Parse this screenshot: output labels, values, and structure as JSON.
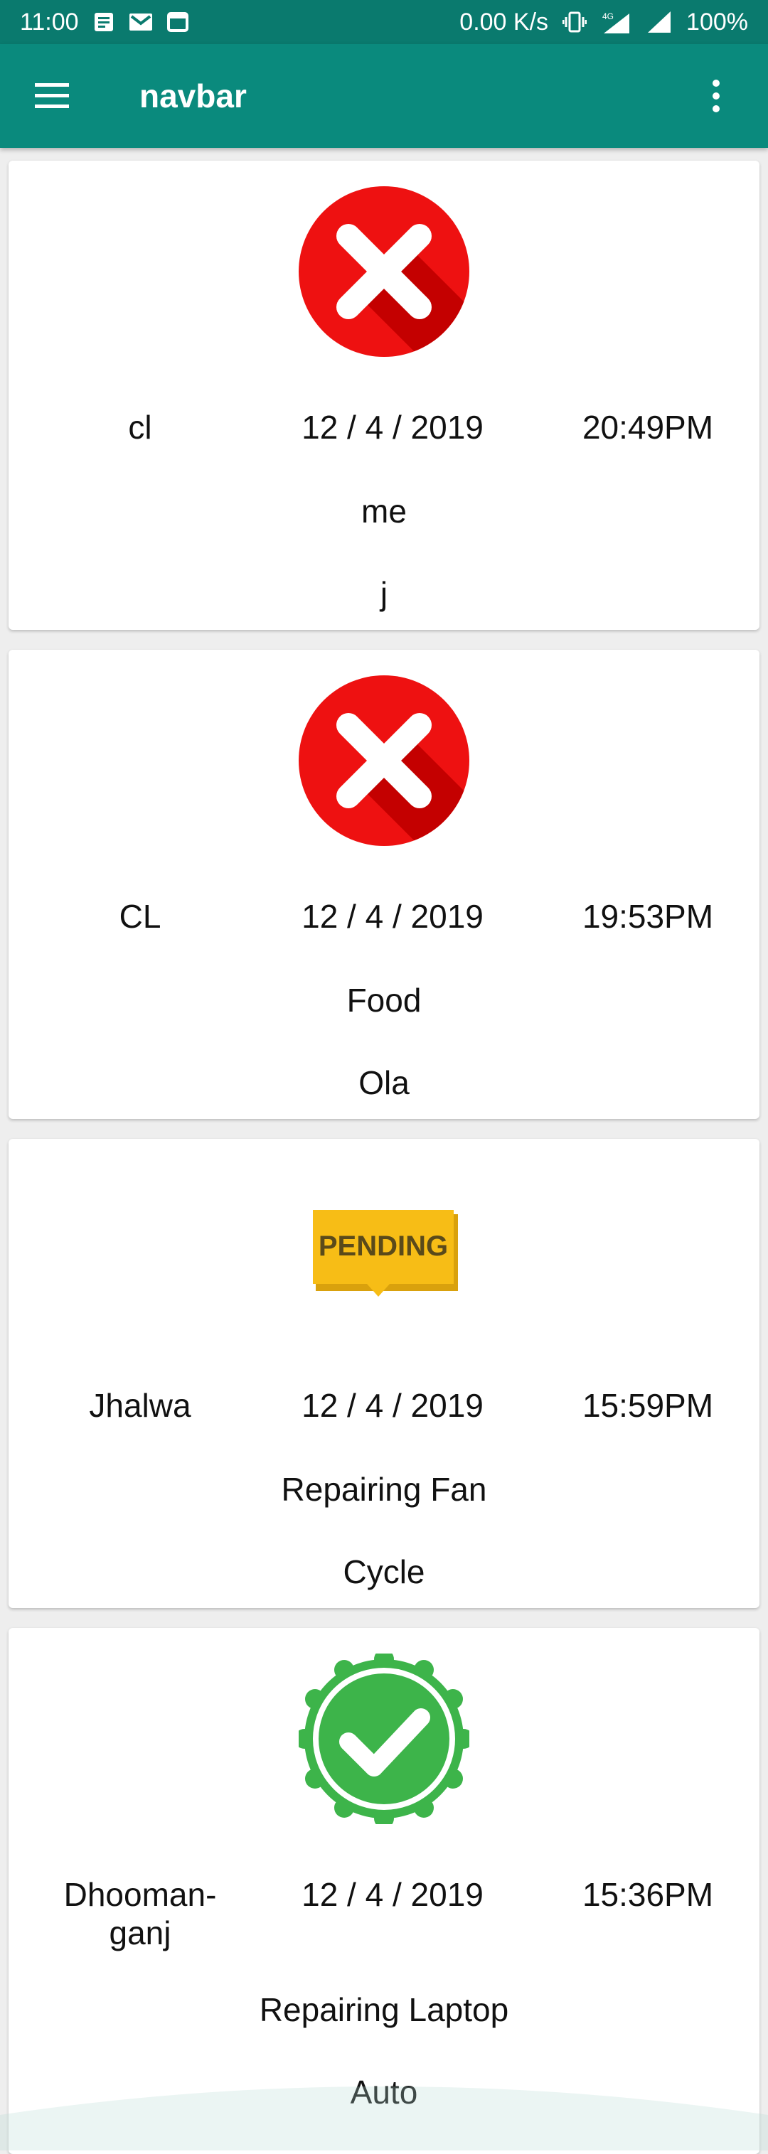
{
  "status_bar": {
    "time": "11:00",
    "network_speed": "0.00 K/s",
    "network_type": "4G",
    "battery": "100%",
    "icons": [
      "notes-icon",
      "gmail-icon",
      "window-icon",
      "vibrate-icon",
      "signal-icon",
      "signal-icon"
    ]
  },
  "app_bar": {
    "title": "navbar",
    "menu_icon": "hamburger-icon",
    "overflow_icon": "more-vert-icon",
    "color": "#0a8a7d"
  },
  "cards": [
    {
      "status": "rejected",
      "status_icon": "cross-icon",
      "name": "cl",
      "date": "12 / 4 / 2019",
      "time": "20:49PM",
      "service": "me",
      "detail": "j"
    },
    {
      "status": "rejected",
      "status_icon": "cross-icon",
      "name": "CL",
      "date": "12 / 4 / 2019",
      "time": "19:53PM",
      "service": "Food",
      "detail": "Ola"
    },
    {
      "status": "pending",
      "status_icon": "pending-badge-icon",
      "badge_text": "PENDING",
      "name": "Jhalwa",
      "date": "12 / 4 / 2019",
      "time": "15:59PM",
      "service": "Repairing Fan",
      "detail": "Cycle"
    },
    {
      "status": "approved",
      "status_icon": "check-badge-icon",
      "name": "Dhooman-\nganj",
      "date": "12 / 4 / 2019",
      "time": "15:36PM",
      "service": "Repairing Laptop",
      "detail": "Auto"
    }
  ],
  "colors": {
    "rejected": "#ee1111",
    "pending": "#f7bd16",
    "approved": "#3db44a"
  }
}
